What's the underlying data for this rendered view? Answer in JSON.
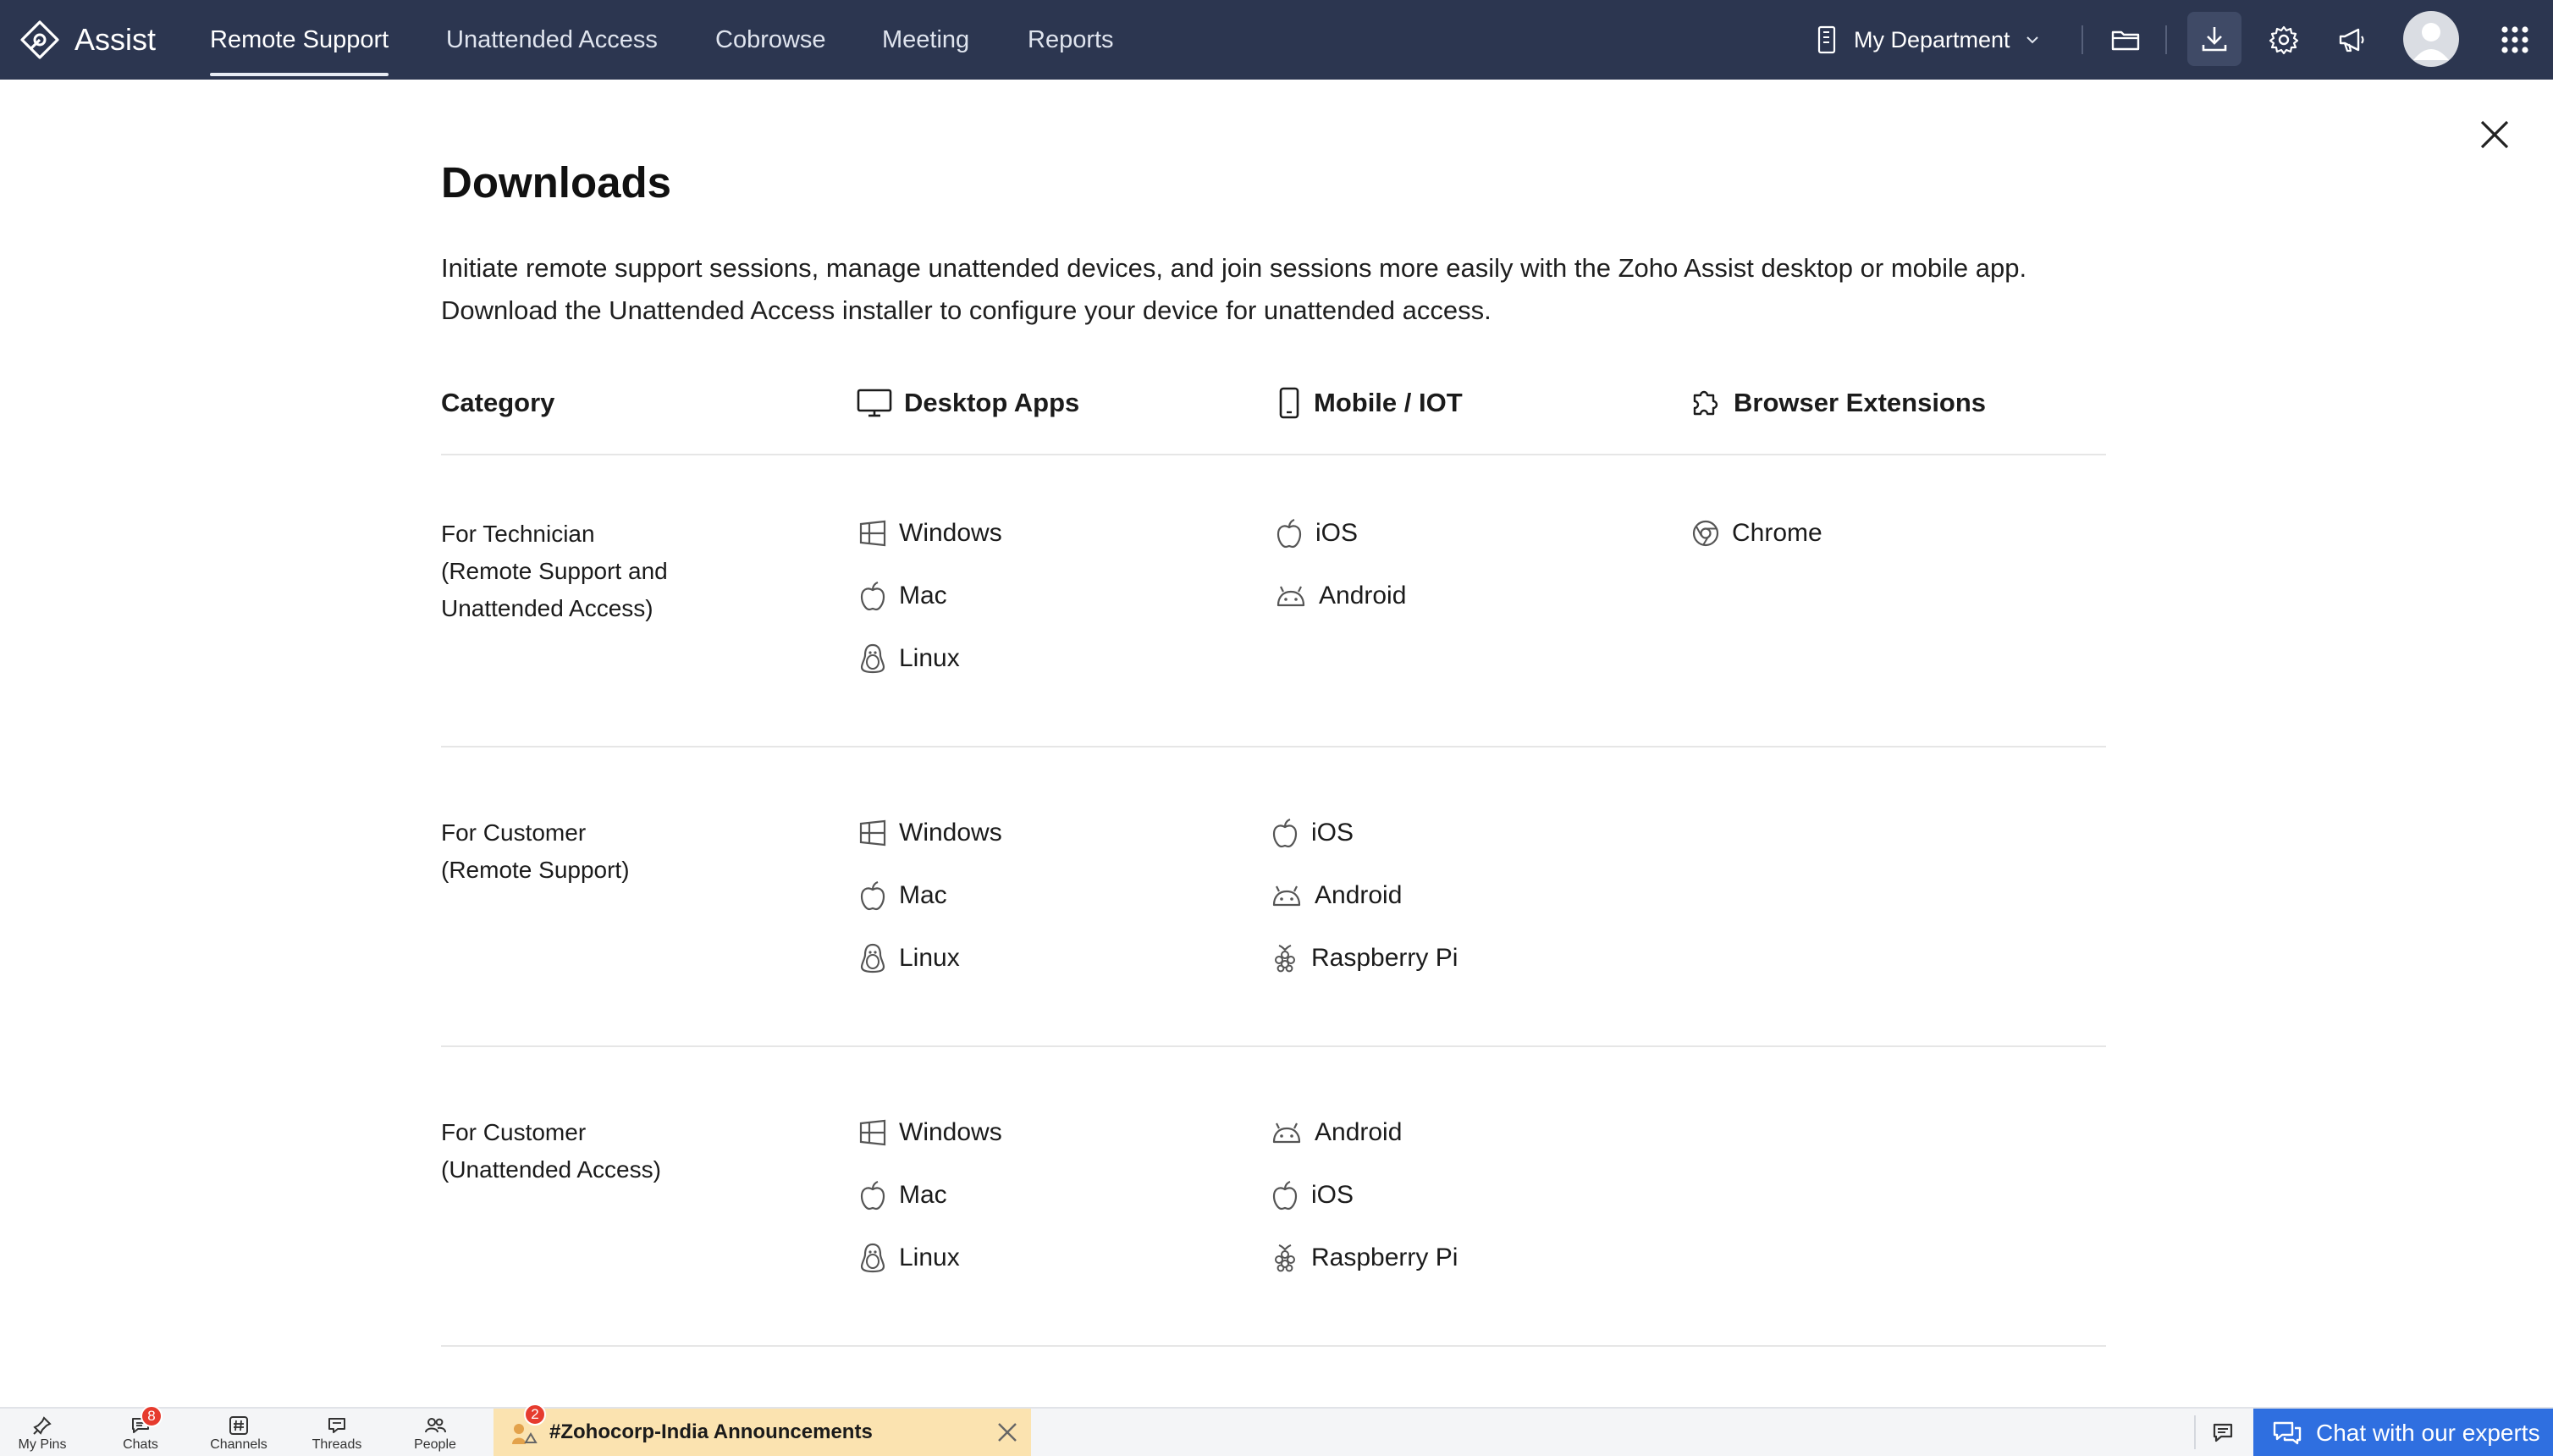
{
  "app": {
    "name": "Assist"
  },
  "nav": {
    "tabs": [
      {
        "label": "Remote Support",
        "active": true
      },
      {
        "label": "Unattended Access"
      },
      {
        "label": "Cobrowse"
      },
      {
        "label": "Meeting"
      },
      {
        "label": "Reports"
      }
    ]
  },
  "header": {
    "department": "My Department",
    "icons": [
      "folder-icon",
      "download-icon",
      "gear-icon",
      "megaphone-icon",
      "avatar",
      "apps-grid-icon"
    ]
  },
  "page": {
    "title": "Downloads",
    "description_line1": "Initiate remote support sessions, manage unattended devices, and join sessions more easily with the Zoho Assist desktop or mobile app.",
    "description_line2": "Download the Unattended Access installer to configure your device for unattended access."
  },
  "columns": {
    "category": "Category",
    "desktop": "Desktop Apps",
    "mobile": "Mobile / IOT",
    "browser": "Browser Extensions"
  },
  "sections": [
    {
      "line1": "For Technician",
      "line2": "(Remote Support and",
      "line3": "Unattended Access)",
      "desktop": [
        "Windows",
        "Mac",
        "Linux"
      ],
      "mobile": [
        "iOS",
        "Android"
      ],
      "browser": [
        "Chrome"
      ]
    },
    {
      "line1": "For Customer",
      "line2": "(Remote Support)",
      "desktop": [
        "Windows",
        "Mac",
        "Linux"
      ],
      "mobile": [
        "iOS",
        "Android",
        "Raspberry Pi"
      ]
    },
    {
      "line1": "For Customer",
      "line2": "(Unattended Access)",
      "desktop": [
        "Windows",
        "Mac",
        "Linux"
      ],
      "mobile": [
        "Android",
        "iOS",
        "Raspberry Pi"
      ]
    }
  ],
  "bottom_bar": {
    "my_pins": "My Pins",
    "chats": "Chats",
    "chats_badge": "8",
    "channels": "Channels",
    "threads": "Threads",
    "people": "People",
    "announcement": "#Zohocorp-India Announcements",
    "announcement_badge": "2",
    "chat_experts": "Chat with our experts"
  },
  "colors": {
    "topbar": "#2c3650",
    "accent_blue": "#2f6fe0",
    "announcement_bg": "#fbe3b0",
    "badge_red": "#e63b2e"
  }
}
